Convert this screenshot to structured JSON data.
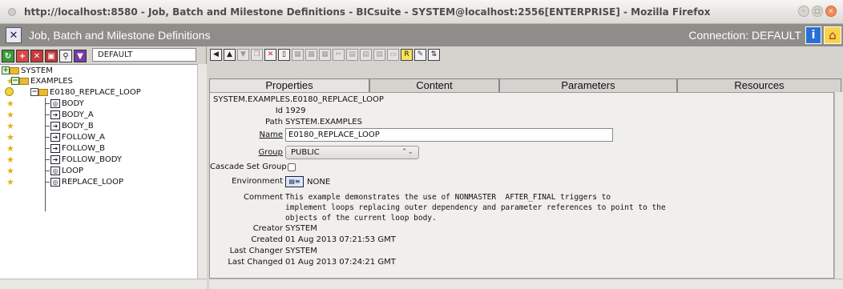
{
  "window": {
    "title": "http://localhost:8580 - Job, Batch and Milestone Definitions - BICsuite - SYSTEM@localhost:2556[ENTERPRISE] - Mozilla Firefox"
  },
  "app": {
    "title": "Job, Batch and Milestone Definitions",
    "connection": "Connection: DEFAULT"
  },
  "left": {
    "filter": "DEFAULT",
    "tree": [
      {
        "label": "SYSTEM",
        "kind": "folder"
      },
      {
        "label": "EXAMPLES",
        "kind": "folder"
      },
      {
        "label": "E0180_REPLACE_LOOP",
        "kind": "folder"
      },
      {
        "label": "BODY",
        "kind": "batch"
      },
      {
        "label": "BODY_A",
        "kind": "job"
      },
      {
        "label": "BODY_B",
        "kind": "job"
      },
      {
        "label": "FOLLOW_A",
        "kind": "job"
      },
      {
        "label": "FOLLOW_B",
        "kind": "job"
      },
      {
        "label": "FOLLOW_BODY",
        "kind": "job"
      },
      {
        "label": "LOOP",
        "kind": "batch"
      },
      {
        "label": "REPLACE_LOOP",
        "kind": "batch"
      }
    ]
  },
  "tabs": [
    {
      "label": "Properties"
    },
    {
      "label": "Content"
    },
    {
      "label": "Parameters"
    },
    {
      "label": "Resources"
    }
  ],
  "details": {
    "fullname": "SYSTEM.EXAMPLES.E0180_REPLACE_LOOP",
    "id_label": "Id",
    "id_value": "1929",
    "path_label": "Path",
    "path_value": "SYSTEM.EXAMPLES",
    "name_label": "Name",
    "name_value": "E0180_REPLACE_LOOP",
    "group_label": "Group",
    "group_value": "PUBLIC",
    "cascade_label": "Cascade Set Group",
    "env_label": "Environment",
    "env_value": "NONE",
    "comment_label": "Comment",
    "comment_line1": "This example demonstrates the use of NONMASTER  AFTER_FINAL triggers to",
    "comment_line2": "implement loops replacing outer dependency and parameter references to point to the",
    "comment_line3": "objects of the current loop body.",
    "creator_label": "Creator",
    "creator_value": "SYSTEM",
    "created_label": "Created",
    "created_value": "01 Aug 2013 07:21:53 GMT",
    "changer_label": "Last Changer",
    "changer_value": "SYSTEM",
    "changed_label": "Last Changed",
    "changed_value": "01 Aug 2013 07:24:21 GMT"
  }
}
